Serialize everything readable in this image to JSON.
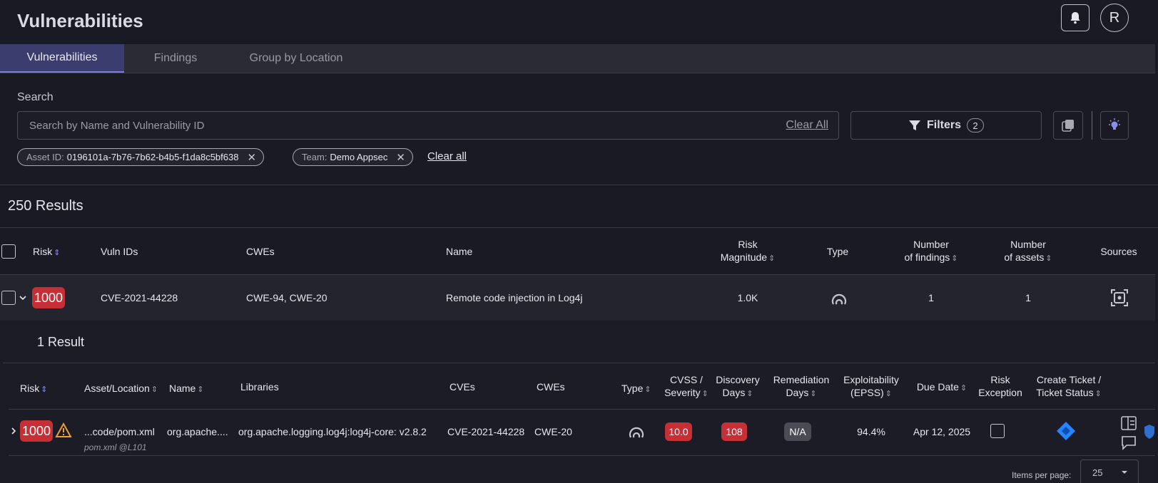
{
  "header": {
    "title": "Vulnerabilities",
    "avatar_letter": "R"
  },
  "tabs": [
    {
      "label": "Vulnerabilities",
      "active": true
    },
    {
      "label": "Findings",
      "active": false
    },
    {
      "label": "Group by Location",
      "active": false
    }
  ],
  "search": {
    "label": "Search",
    "placeholder": "Search by Name and Vulnerability ID",
    "value": "",
    "clear_label": "Clear All"
  },
  "filters": {
    "label": "Filters",
    "count": "2"
  },
  "chips": [
    {
      "key": "Asset ID:",
      "value": "0196101a-7b76-7b62-b4b5-f1da8c5bf638"
    },
    {
      "key": "Team:",
      "value": "Demo Appsec"
    }
  ],
  "chips_clear_label": "Clear all",
  "results_label": "250 Results",
  "table": {
    "columns": {
      "risk": "Risk",
      "vuln_ids": "Vuln IDs",
      "cwes": "CWEs",
      "name": "Name",
      "risk_magnitude_1": "Risk",
      "risk_magnitude_2": "Magnitude",
      "type": "Type",
      "findings_1": "Number",
      "findings_2": "of findings",
      "assets_1": "Number",
      "assets_2": "of assets",
      "sources": "Sources"
    },
    "row": {
      "risk": "1000",
      "vuln_ids": "CVE-2021-44228",
      "cwes": "CWE-94, CWE-20",
      "name": "Remote code injection in Log4j",
      "risk_magnitude": "1.0K",
      "findings": "1",
      "assets": "1"
    }
  },
  "subtable": {
    "results_label": "1 Result",
    "columns": {
      "risk": "Risk",
      "asset": "Asset/Location",
      "name": "Name",
      "libraries": "Libraries",
      "cves": "CVEs",
      "cwes": "CWEs",
      "type": "Type",
      "cvss_1": "CVSS /",
      "cvss_2": "Severity",
      "discovery_1": "Discovery",
      "discovery_2": "Days",
      "remediation_1": "Remediation",
      "remediation_2": "Days",
      "epss_1": "Exploitability",
      "epss_2": "(EPSS)",
      "due": "Due Date",
      "exception_1": "Risk",
      "exception_2": "Exception",
      "ticket_1": "Create Ticket /",
      "ticket_2": "Ticket Status"
    },
    "row": {
      "risk": "1000",
      "asset": "...code/pom.xml",
      "asset_sub": "pom.xml @L101",
      "name": "org.apache....",
      "library": "org.apache.logging.log4j:log4j-core: v2.8.2",
      "cve": "CVE-2021-44228",
      "cwe": "CWE-20",
      "cvss": "10.0",
      "discovery": "108",
      "remediation": "N/A",
      "epss": "94.4%",
      "due": "Apr 12, 2025"
    }
  },
  "pagination": {
    "items_per_page_label": "Items per page:",
    "value": "25"
  },
  "colors": {
    "accent": "#7a7ee0",
    "danger": "#c62f35",
    "background": "#191a24",
    "jira_blue": "#2684ff"
  }
}
